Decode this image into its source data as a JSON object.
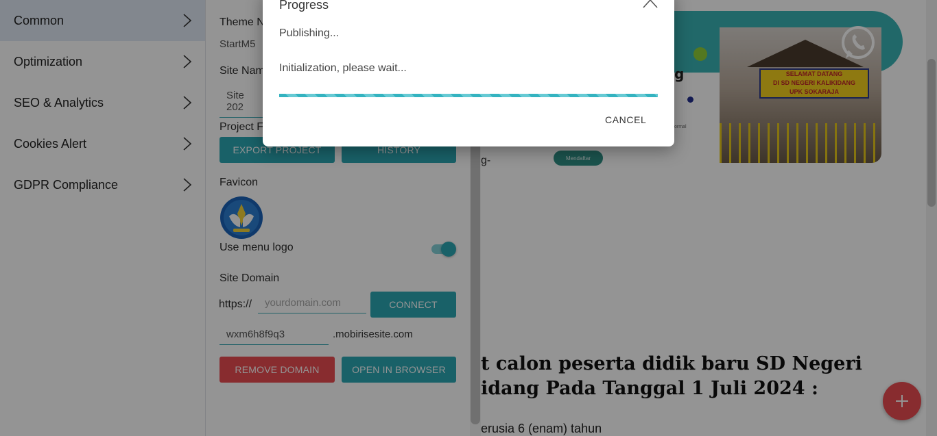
{
  "sidebar": {
    "items": [
      {
        "label": "Common"
      },
      {
        "label": "Optimization"
      },
      {
        "label": "SEO & Analytics"
      },
      {
        "label": "Cookies Alert"
      },
      {
        "label": "GDPR Compliance"
      }
    ]
  },
  "settings": {
    "theme_name_label": "Theme N",
    "theme_name_value": "StartM5",
    "site_name_label": "Site Nam",
    "site_name_value": "Site 202",
    "project_files_label": "Project Fi",
    "export_button": "EXPORT PROJECT",
    "history_button": "HISTORY",
    "favicon_label": "Favicon",
    "use_menu_logo_label": "Use menu logo",
    "use_menu_logo_on": true,
    "site_domain_label": "Site Domain",
    "domain_prefix": "https://",
    "domain_placeholder": "yourdomain.com",
    "connect_button": "CONNECT",
    "subdomain_value": "wxm6h8f9q3",
    "subdomain_suffix": ".mobirisesite.com",
    "remove_domain_button": "REMOVE DOMAIN",
    "open_browser_button": "OPEN IN BROWSER"
  },
  "preview": {
    "fragment_g": "g",
    "fragment_dash": "g-",
    "fragment_small": "ormal",
    "badge_text": "Mendaftar",
    "sign_line1": "SELAMAT DATANG",
    "sign_line2": "DI SD NEGERI KALIKIDANG",
    "sign_line3": "UPK SOKARAJA",
    "heading_line1": "t calon peserta didik baru SD Negeri",
    "heading_line2": "idang Pada Tanggal 1 Juli 2024 :",
    "paragraph": "erusia 6 (enam) tahun"
  },
  "modal": {
    "title": "Progress",
    "status": "Publishing...",
    "message": "Initialization, please wait...",
    "cancel_button": "CANCEL"
  },
  "icons": {
    "chevron": "chevron-right-icon",
    "close": "close-icon",
    "whatsapp": "whatsapp-icon",
    "add": "plus-icon"
  },
  "colors": {
    "accent": "#2ba7b4",
    "danger": "#ea4c51",
    "sidebar_active": "#e1e9f5"
  }
}
